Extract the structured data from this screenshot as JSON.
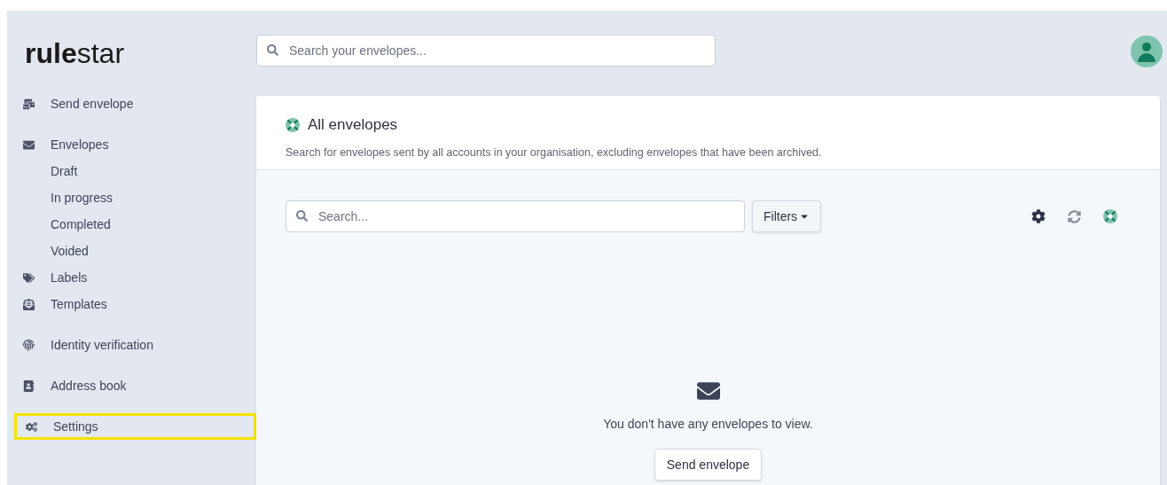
{
  "logo": "**rule**star",
  "search": {
    "placeholder": "Search your envelopes..."
  },
  "sidebar": {
    "groups": [
      [
        {
          "label": "Send envelope",
          "highlighted": false
        }
      ],
      [
        {
          "label": "Envelopes",
          "highlighted": false,
          "children": [
            {
              "label": "Draft",
              "highlighted": false
            },
            {
              "label": "In progress",
              "highlighted": false
            },
            {
              "label": "Completed",
              "highlighted": false
            },
            {
              "label": "Voided",
              "highlighted": false
            }
          ]
        },
        {
          "label": "Labels",
          "highlighted": false
        },
        {
          "label": "Templates",
          "highlighted": false
        }
      ],
      [
        {
          "label": "Identity verification",
          "highlighted": false
        }
      ],
      [
        {
          "label": "Address book",
          "highlighted": false
        }
      ],
      [
        {
          "label": "Settings",
          "highlighted": true
        }
      ]
    ]
  },
  "panel": {
    "title": "All envelopes",
    "description": "Search for envelopes sent by all accounts in your organisation, excluding envelopes that have been archived.",
    "search": {
      "placeholder": "Search..."
    },
    "filters_button": "Filters",
    "empty_message": "You don't have any envelopes to view.",
    "empty_button": "Send envelope"
  }
}
